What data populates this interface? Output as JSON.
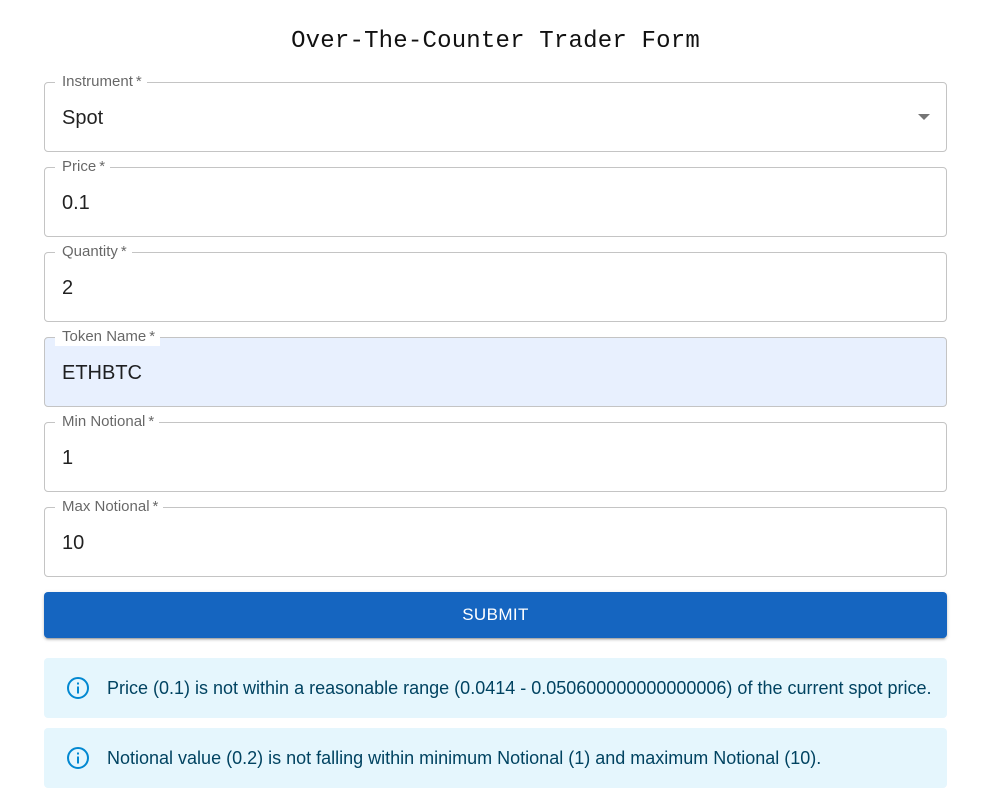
{
  "form": {
    "title": "Over-The-Counter Trader Form",
    "required_marker": "*",
    "fields": {
      "instrument": {
        "label": "Instrument",
        "value": "Spot"
      },
      "price": {
        "label": "Price",
        "value": "0.1"
      },
      "quantity": {
        "label": "Quantity",
        "value": "2"
      },
      "token_name": {
        "label": "Token Name",
        "value": "ETHBTC"
      },
      "min_notional": {
        "label": "Min Notional",
        "value": "1"
      },
      "max_notional": {
        "label": "Max Notional",
        "value": "10"
      }
    },
    "submit_label": "Submit"
  },
  "alerts": [
    {
      "icon": "info-icon",
      "message": "Price (0.1) is not within a reasonable range (0.0414 - 0.050600000000000006) of the current spot price."
    },
    {
      "icon": "info-icon",
      "message": "Notional value (0.2) is not falling within minimum Notional (1) and maximum Notional (10)."
    }
  ],
  "colors": {
    "primary": "#1565c0",
    "info_background": "#e5f6fd",
    "info_text": "#014361",
    "info_icon": "#0288d1",
    "autofill_background": "#e8f0fe"
  }
}
